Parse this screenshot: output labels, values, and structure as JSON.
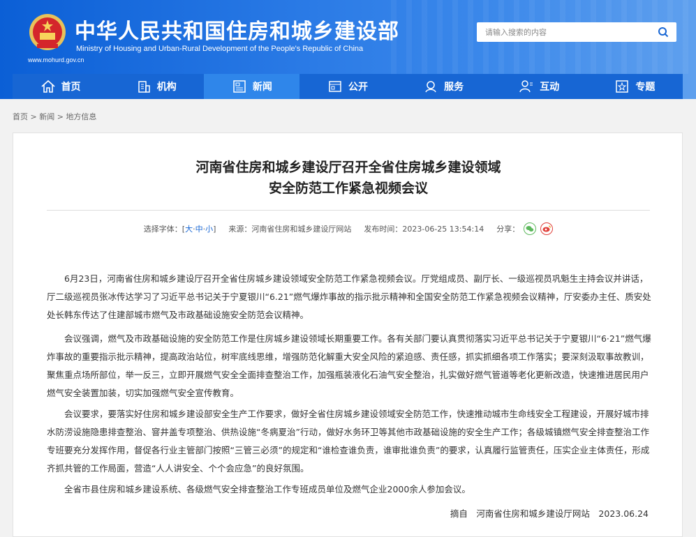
{
  "header": {
    "title": "中华人民共和国住房和城乡建设部",
    "subtitle": "Ministry of Housing and Urban-Rural Development of the People's Republic of China",
    "url": "www.mohurd.gov.cn",
    "search_placeholder": "请输入搜索的内容"
  },
  "nav": {
    "items": [
      {
        "label": "首页",
        "icon": "home-icon"
      },
      {
        "label": "机构",
        "icon": "building-icon"
      },
      {
        "label": "新闻",
        "icon": "news-icon"
      },
      {
        "label": "公开",
        "icon": "disclosure-icon"
      },
      {
        "label": "服务",
        "icon": "service-icon"
      },
      {
        "label": "互动",
        "icon": "interaction-icon"
      },
      {
        "label": "专题",
        "icon": "topic-icon"
      }
    ],
    "active": "新闻"
  },
  "breadcrumb": {
    "home": "首页",
    "news": "新闻",
    "local": "地方信息",
    "sep": " > "
  },
  "article": {
    "title_line1": "河南省住房和城乡建设厅召开全省住房城乡建设领域",
    "title_line2": "安全防范工作紧急视频会议",
    "font_size_label": "选择字体：[",
    "size_large": "大",
    "size_medium": "中",
    "size_small": "小",
    "font_size_close": "]",
    "source_label": "来源：河南省住房和城乡建设厅网站",
    "time_label": "发布时间：2023-06-25 13:54:14",
    "share_label": "分享：",
    "paragraphs": [
      "6月23日，河南省住房和城乡建设厅召开全省住房城乡建设领域安全防范工作紧急视频会议。厅党组成员、副厅长、一级巡视员巩魁生主持会议并讲话，厅二级巡视员张冰传达学习了习近平总书记关于宁夏银川“6.21”燃气爆炸事故的指示批示精神和全国安全防范工作紧急视频会议精神，厅安委办主任、质安处处长韩东传达了住建部城市燃气及市政基础设施安全防范会议精神。",
      "会议强调，燃气及市政基础设施的安全防范工作是住房城乡建设领域长期重要工作。各有关部门要认真贯彻落实习近平总书记关于宁夏银川“6·21”燃气爆炸事故的重要指示批示精神，提高政治站位，树牢底线思维，增强防范化解重大安全风险的紧迫感、责任感，抓实抓细各项工作落实；要深刻汲取事故教训，聚焦重点场所部位，举一反三，立即开展燃气安全全面排查整治工作，加强瓶装液化石油气安全整治，扎实做好燃气管道等老化更新改造，快速推进居民用户燃气安全装置加装，切实加强燃气安全宣传教育。",
      "会议要求，要落实好住房和城乡建设部安全生产工作要求，做好全省住房城乡建设领域安全防范工作，快速推动城市生命线安全工程建设，开展好城市排水防涝设施隐患排查整治、窨井盖专项整治、供热设施“冬病夏治”行动，做好水务环卫等其他市政基础设施的安全生产工作；各级城镇燃气安全排查整治工作专班要充分发挥作用，督促各行业主管部门按照“三管三必须”的规定和“谁检查谁负责，谁审批谁负责”的要求，认真履行监管责任，压实企业主体责任，形成齐抓共管的工作局面，营造“人人讲安全、个个会应急”的良好氛围。",
      "全省市县住房和城乡建设系统、各级燃气安全排查整治工作专班成员单位及燃气企业2000余人参加会议。"
    ],
    "excerpt_source": "摘自　河南省住房和城乡建设厅网站　2023.06.24"
  }
}
